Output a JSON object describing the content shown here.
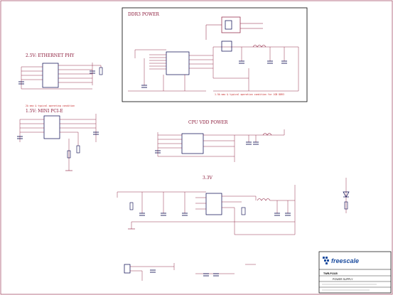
{
  "sections": {
    "ddr3": "DDR3 POWER",
    "ethernet": "2.5V: ETHERNET PHY",
    "minipci": "1.5V: MINI PCI-E",
    "cpu": "CPU VDD POWER",
    "v33": "3.3V"
  },
  "notes": {
    "ddr3": "1.5A max & typical operation condition for 1GB DDR3",
    "minipci": "2A max & typical operating condition"
  },
  "title_block": {
    "brand": "freescale",
    "title": "TWR-P1025",
    "page_title": "POWER SUPPLY"
  },
  "colors": {
    "wire": "#8b1a3a",
    "text_red": "#c62828",
    "component": "#00004a",
    "net": "#333333"
  }
}
